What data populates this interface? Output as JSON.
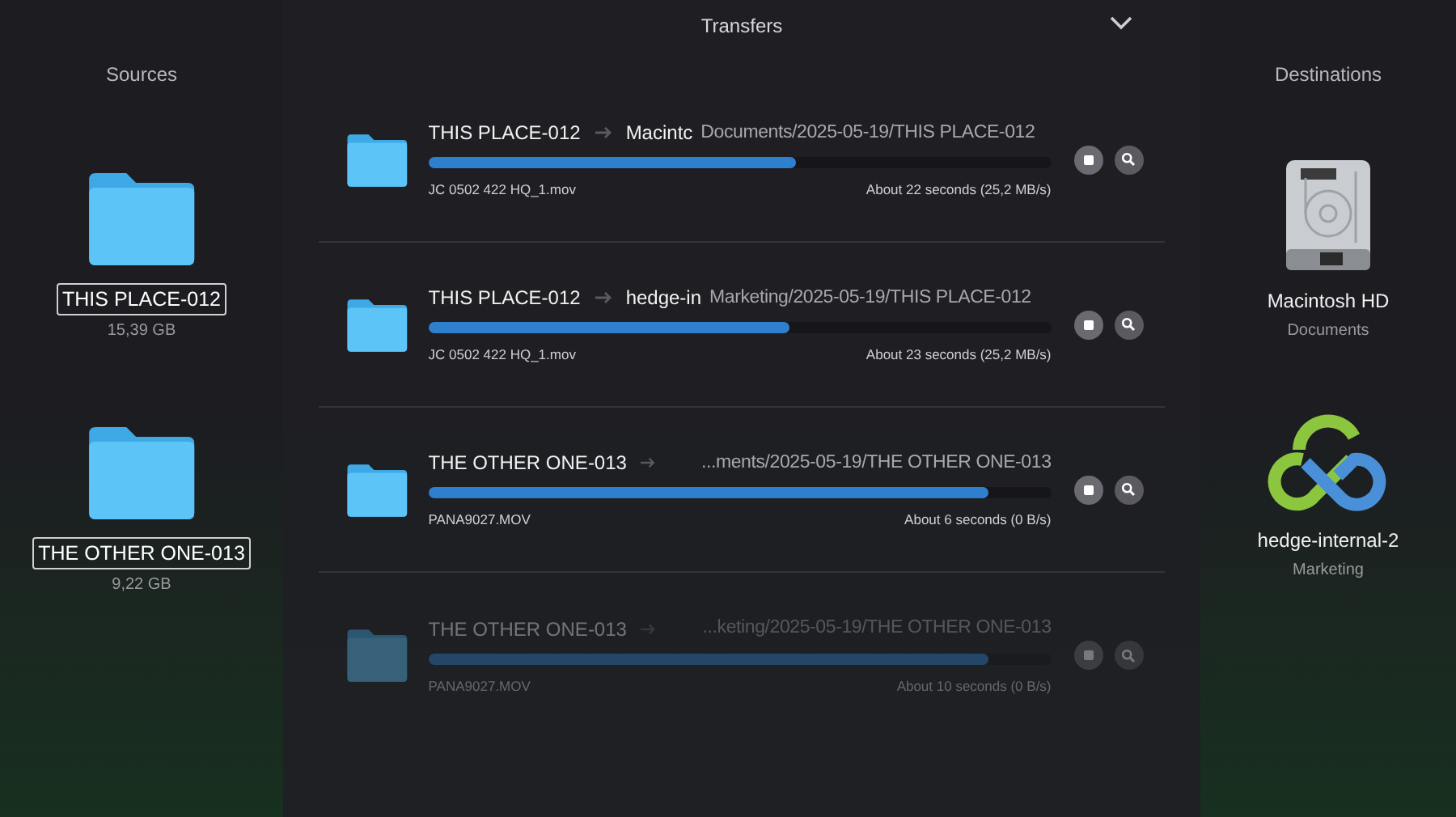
{
  "sources": {
    "title": "Sources",
    "items": [
      {
        "name": "THIS PLACE-012",
        "size": "15,39 GB"
      },
      {
        "name": "THE OTHER ONE-013",
        "size": "9,22 GB"
      }
    ]
  },
  "transfers": {
    "title": "Transfers",
    "rows": [
      {
        "source": "THIS PLACE-012",
        "destination": "Macintc",
        "path": "Documents/2025-05-19/THIS PLACE-012",
        "level": 0.59,
        "file": "JC 0502 422 HQ_1.mov",
        "eta": "About 22 seconds (25,2 MB/s)",
        "faded": false
      },
      {
        "source": "THIS PLACE-012",
        "destination": "hedge-in",
        "path": "Marketing/2025-05-19/THIS PLACE-012",
        "level": 0.58,
        "file": "JC 0502 422 HQ_1.mov",
        "eta": "About 23 seconds (25,2 MB/s)",
        "faded": false
      },
      {
        "source": "THE OTHER ONE-013",
        "path": "...ments/2025-05-19/THE OTHER ONE-013",
        "level": 0.9,
        "file": "PANA9027.MOV",
        "eta": "About 6 seconds (0 B/s)",
        "faded": false
      },
      {
        "source": "THE OTHER ONE-013",
        "path": "...keting/2025-05-19/THE OTHER ONE-013",
        "level": 0.9,
        "file": "PANA9027.MOV",
        "eta": "About 10 seconds (0 B/s)",
        "faded": true
      }
    ]
  },
  "destinations": {
    "title": "Destinations",
    "items": [
      {
        "kind": "disk",
        "name": "Macintosh HD",
        "folder": "Documents"
      },
      {
        "kind": "cloud",
        "name": "hedge-internal-2",
        "folder": "Marketing"
      }
    ]
  }
}
